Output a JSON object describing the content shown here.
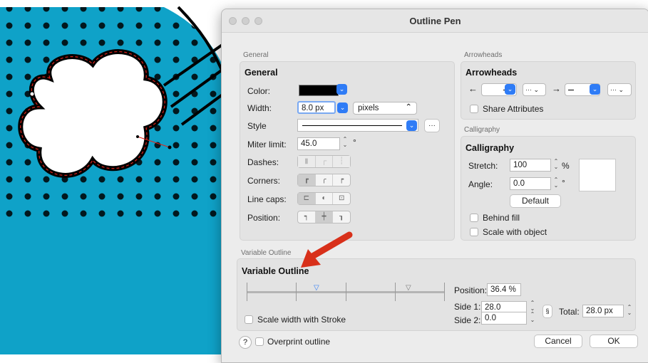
{
  "window": {
    "title": "Outline Pen"
  },
  "general": {
    "caption": "General",
    "title": "General",
    "color_label": "Color:",
    "width_label": "Width:",
    "width_value": "8.0 px",
    "units_value": "pixels",
    "style_label": "Style",
    "style_more": "···",
    "miter_label": "Miter limit:",
    "miter_value": "45.0",
    "miter_unit": "°",
    "dashes_label": "Dashes:",
    "corners_label": "Corners:",
    "linecaps_label": "Line caps:",
    "position_label": "Position:"
  },
  "arrowheads": {
    "caption": "Arrowheads",
    "title": "Arrowheads",
    "more": "···",
    "share_label": "Share Attributes"
  },
  "calligraphy": {
    "caption": "Calligraphy",
    "title": "Calligraphy",
    "stretch_label": "Stretch:",
    "stretch_value": "100",
    "stretch_unit": "%",
    "angle_label": "Angle:",
    "angle_value": "0.0",
    "angle_unit": "°",
    "default_label": "Default",
    "behind_fill_label": "Behind fill",
    "scale_object_label": "Scale with object"
  },
  "variable": {
    "caption": "Variable Outline",
    "title": "Variable Outline",
    "position_label": "Position:",
    "position_value": "36.4 %",
    "side1_label": "Side 1:",
    "side1_value": "28.0",
    "side2_label": "Side 2:",
    "side2_value": "0.0",
    "total_label": "Total:",
    "total_value": "28.0 px",
    "scale_stroke_label": "Scale width with Stroke"
  },
  "footer": {
    "help": "?",
    "overprint_label": "Overprint outline",
    "cancel_label": "Cancel",
    "ok_label": "OK"
  },
  "colors": {
    "canvas_bg": "#0fa2c8",
    "accent_blue": "#2f7cf6",
    "arrow_red": "#d8301a",
    "dialog_bg": "#ececec"
  }
}
